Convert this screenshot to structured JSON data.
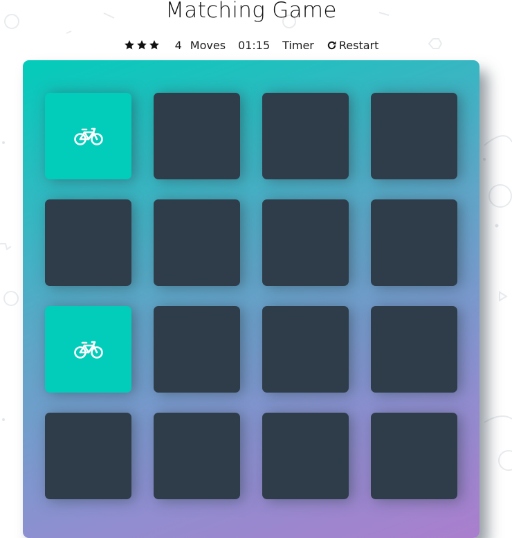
{
  "title": "Matching Game",
  "score_panel": {
    "stars": [
      "star-icon",
      "star-icon",
      "star-icon"
    ],
    "moves_count": "4",
    "moves_label": "Moves",
    "timer_value": "01:15",
    "timer_label": "Timer",
    "restart_label": "Restart"
  },
  "deck": {
    "cards": [
      {
        "state": "open",
        "icon": "bicycle-icon"
      },
      {
        "state": "closed"
      },
      {
        "state": "closed"
      },
      {
        "state": "closed"
      },
      {
        "state": "closed"
      },
      {
        "state": "closed"
      },
      {
        "state": "closed"
      },
      {
        "state": "closed"
      },
      {
        "state": "open",
        "icon": "bicycle-icon"
      },
      {
        "state": "closed"
      },
      {
        "state": "closed"
      },
      {
        "state": "closed"
      },
      {
        "state": "closed"
      },
      {
        "state": "closed"
      },
      {
        "state": "closed"
      },
      {
        "state": "closed"
      }
    ]
  },
  "colors": {
    "card_back": "#2e3d49",
    "card_open": "#02ccba",
    "deck_gradient_start": "#02ccba",
    "deck_gradient_end": "#aa7ecd"
  }
}
